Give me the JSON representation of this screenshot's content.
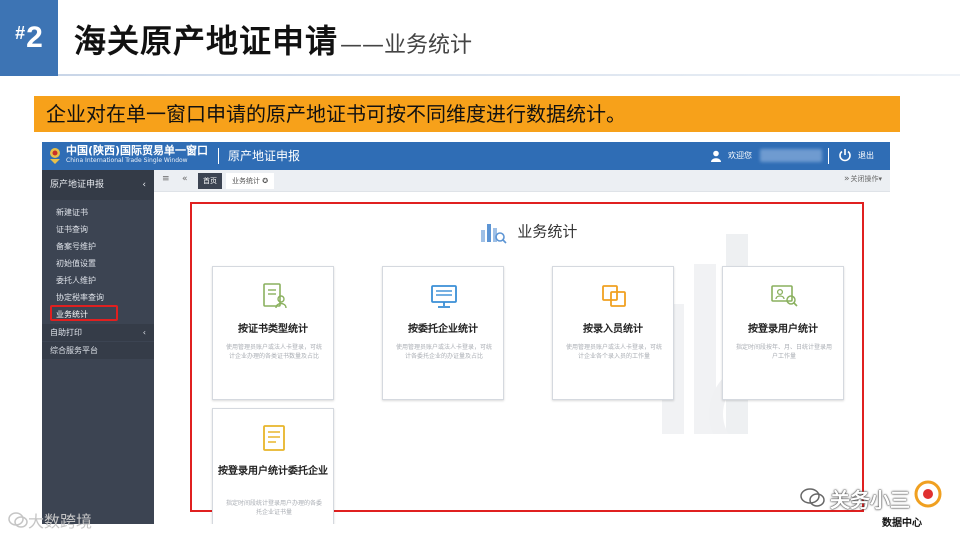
{
  "slide": {
    "badge_hash": "#",
    "badge_num": "2",
    "title": "海关原产地证申请",
    "title_dash": "——",
    "subtitle": "业务统计",
    "banner": "企业对在单一窗口申请的原产地证书可按不同维度进行数据统计。"
  },
  "app": {
    "brand": "中国(陕西)国际贸易单一窗口",
    "brand_en": "China International Trade Single Window",
    "section": "原产地证申报",
    "welcome": "欢迎您",
    "logout": "退出",
    "sidebar": {
      "header": "原产地证申报",
      "items": [
        "新建证书",
        "证书查询",
        "备案号维护",
        "初始值设置",
        "委托人维护",
        "协定税率查询",
        "业务统计"
      ],
      "groups": [
        "自助打印",
        "综合服务平台"
      ]
    },
    "tabs": {
      "home": "首页",
      "current": "业务统计",
      "close_ops": "关闭操作"
    },
    "panel_title": "业务统计",
    "cards": [
      {
        "title": "按证书类型统计",
        "desc": "使用管理员账户或法人卡登录，可统计企业办理的各类证书数量及占比",
        "icon": "certificate-user-icon"
      },
      {
        "title": "按委托企业统计",
        "desc": "使用管理员账户或法人卡登录，可统计各委托企业的办证量及占比",
        "icon": "monitor-icon"
      },
      {
        "title": "按录入员统计",
        "desc": "使用管理员账户或法人卡登录，可统计企业各个录入员的工作量",
        "icon": "copy-icon"
      },
      {
        "title": "按登录用户统计",
        "desc": "指定时间段按年、月、日统计登录用户工作量",
        "icon": "user-search-icon"
      },
      {
        "title": "按登录用户统计委托企业",
        "desc": "指定时间段统计登录用户办理的各委托企业证书量",
        "icon": "document-list-icon"
      }
    ]
  },
  "watermarks": {
    "left": "大数跨境",
    "right": "关务小三",
    "right_sub": "数据中心"
  },
  "colors": {
    "badge": "#3d74b4",
    "banner": "#f7a11a",
    "topbar": "#2f6db5",
    "sidebar": "#3c4452",
    "highlight": "#e02020"
  }
}
